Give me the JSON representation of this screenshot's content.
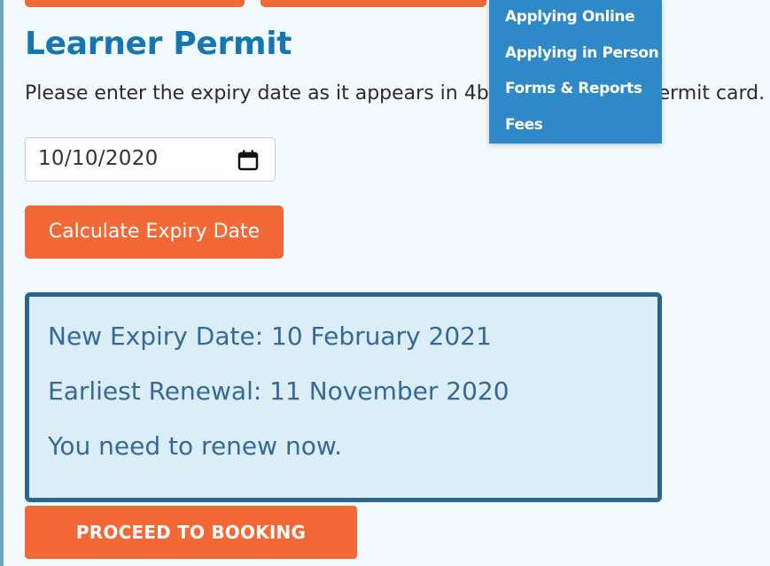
{
  "page": {
    "title": "Learner Permit",
    "instruction": "Please enter the expiry date as it appears in 4b of your learner permit card."
  },
  "date_input": {
    "value": "10/10/2020"
  },
  "buttons": {
    "calculate": "Calculate Expiry Date",
    "proceed": "PROCEED TO BOOKING"
  },
  "result": {
    "new_expiry": "New Expiry Date: 10 February 2021",
    "earliest_renewal": "Earliest Renewal: 11 November 2020",
    "message": "You need to renew now."
  },
  "dropdown": {
    "items": [
      "Applying Online",
      "Applying in Person",
      "Forms & Reports",
      "Fees"
    ]
  },
  "colors": {
    "accent_orange": "#f26836",
    "title_blue": "#1477b4",
    "result_border": "#2a6592",
    "result_bg": "#dbedf6",
    "menu_bg": "#2f88c8"
  },
  "icons": [
    "calendar-icon"
  ]
}
